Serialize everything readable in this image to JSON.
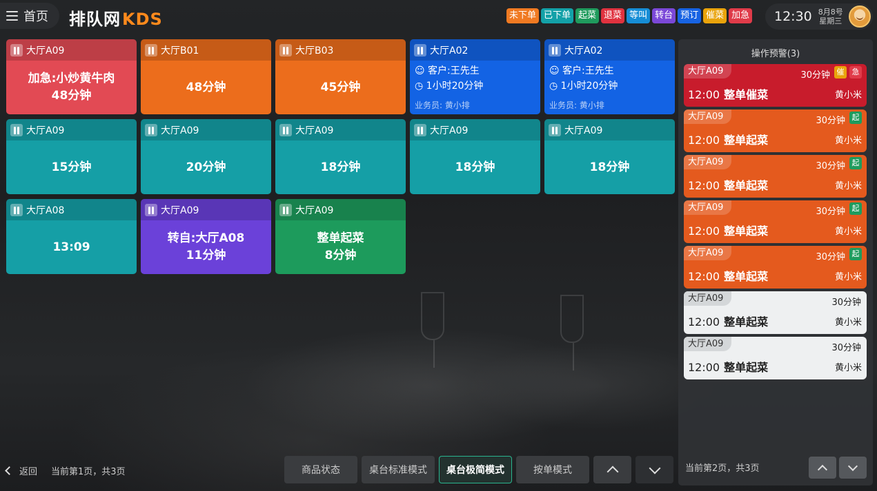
{
  "header": {
    "home_label": "首页",
    "logo_main": "排队网",
    "logo_accent": "KDS",
    "legend": [
      {
        "label": "未下单",
        "color": "#f07a22"
      },
      {
        "label": "已下单",
        "color": "#13a1a8"
      },
      {
        "label": "起菜",
        "color": "#1f9b5d"
      },
      {
        "label": "退菜",
        "color": "#e0323f"
      },
      {
        "label": "等叫",
        "color": "#168dd6"
      },
      {
        "label": "转台",
        "color": "#7b48d8"
      },
      {
        "label": "预订",
        "color": "#1763e3"
      },
      {
        "label": "催菜",
        "color": "#e9a30b"
      },
      {
        "label": "加急",
        "color": "#e03b49"
      }
    ],
    "time": "12:30",
    "date": "8月8号",
    "weekday": "星期三"
  },
  "cards": [
    {
      "table": "大厅A09",
      "color": "red",
      "lines": [
        "加急:小炒黄牛肉",
        "48分钟"
      ]
    },
    {
      "table": "大厅B01",
      "color": "orange",
      "lines": [
        "48分钟"
      ]
    },
    {
      "table": "大厅B03",
      "color": "orange",
      "lines": [
        "45分钟"
      ]
    },
    {
      "table": "大厅A02",
      "color": "blue",
      "customer": "客户:王先生",
      "duration": "1小时20分钟",
      "staff": "业务员: 黄小排"
    },
    {
      "table": "大厅A02",
      "color": "blue",
      "customer": "客户:王先生",
      "duration": "1小时20分钟",
      "staff": "业务员: 黄小排"
    },
    {
      "table": "大厅A09",
      "color": "teal",
      "lines": [
        "15分钟"
      ]
    },
    {
      "table": "大厅A09",
      "color": "teal",
      "lines": [
        "20分钟"
      ]
    },
    {
      "table": "大厅A09",
      "color": "teal",
      "lines": [
        "18分钟"
      ]
    },
    {
      "table": "大厅A09",
      "color": "teal",
      "lines": [
        "18分钟"
      ]
    },
    {
      "table": "大厅A09",
      "color": "teal",
      "lines": [
        "18分钟"
      ]
    },
    {
      "table": "大厅A08",
      "color": "teal",
      "lines": [
        "13:09"
      ]
    },
    {
      "table": "大厅A09",
      "color": "purple",
      "lines": [
        "转自:大厅A08",
        "11分钟"
      ]
    },
    {
      "table": "大厅A09",
      "color": "green",
      "lines": [
        "整单起菜",
        "8分钟"
      ]
    }
  ],
  "panel": {
    "title": "操作预警(3)",
    "alerts": [
      {
        "table": "大厅A09",
        "mins": "30分钟",
        "time": "12:00",
        "action": "整单催菜",
        "who": "黄小米",
        "style": "red",
        "badges": [
          {
            "t": "催",
            "c": "#e9a30b"
          },
          {
            "t": "急",
            "c": "#e03b49"
          }
        ]
      },
      {
        "table": "大厅A09",
        "mins": "30分钟",
        "time": "12:00",
        "action": "整单起菜",
        "who": "黄小米",
        "style": "orange",
        "badges": [
          {
            "t": "起",
            "c": "#1f9b5d"
          }
        ]
      },
      {
        "table": "大厅A09",
        "mins": "30分钟",
        "time": "12:00",
        "action": "整单起菜",
        "who": "黄小米",
        "style": "orange",
        "badges": [
          {
            "t": "起",
            "c": "#1f9b5d"
          }
        ]
      },
      {
        "table": "大厅A09",
        "mins": "30分钟",
        "time": "12:00",
        "action": "整单起菜",
        "who": "黄小米",
        "style": "orange",
        "badges": [
          {
            "t": "起",
            "c": "#1f9b5d"
          }
        ]
      },
      {
        "table": "大厅A09",
        "mins": "30分钟",
        "time": "12:00",
        "action": "整单起菜",
        "who": "黄小米",
        "style": "orange",
        "badges": [
          {
            "t": "起",
            "c": "#1f9b5d"
          }
        ]
      },
      {
        "table": "大厅A09",
        "mins": "30分钟",
        "time": "12:00",
        "action": "整单起菜",
        "who": "黄小米",
        "style": "white",
        "badges": []
      },
      {
        "table": "大厅A09",
        "mins": "30分钟",
        "time": "12:00",
        "action": "整单起菜",
        "who": "黄小米",
        "style": "white",
        "badges": []
      }
    ],
    "page_text": "当前第2页，共3页"
  },
  "footer": {
    "back_label": "返回",
    "page_text": "当前第1页，共3页",
    "modes": [
      {
        "label": "商品状态",
        "active": false
      },
      {
        "label": "桌台标准模式",
        "active": false
      },
      {
        "label": "桌台极简模式",
        "active": true
      },
      {
        "label": "按单模式",
        "active": false
      }
    ]
  }
}
